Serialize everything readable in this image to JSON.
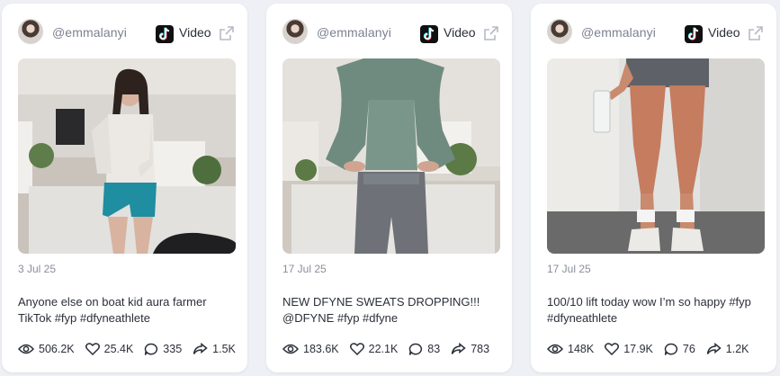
{
  "posts": [
    {
      "username": "@emmalanyi",
      "platform_label": "Video",
      "date": "3 Jul 25",
      "caption": "Anyone else on boat kid aura farmer TikTok #fyp #dfyneathlete",
      "stats": {
        "views": "506.2K",
        "likes": "25.4K",
        "comments": "335",
        "shares": "1.5K"
      }
    },
    {
      "username": "@emmalanyi",
      "platform_label": "Video",
      "date": "17 Jul 25",
      "caption": "NEW DFYNE SWEATS DROPPING!!! @DFYNE #fyp #dfyne",
      "stats": {
        "views": "183.6K",
        "likes": "22.1K",
        "comments": "83",
        "shares": "783"
      }
    },
    {
      "username": "@emmalanyi",
      "platform_label": "Video",
      "date": "17 Jul 25",
      "caption": "100/10 lift today wow I’m so happy #fyp #dfyneathlete",
      "stats": {
        "views": "148K",
        "likes": "17.9K",
        "comments": "76",
        "shares": "1.2K"
      }
    }
  ],
  "icons": {
    "platform": "tiktok-icon",
    "open": "external-link-icon",
    "views": "eye-icon",
    "likes": "heart-icon",
    "comments": "comment-icon",
    "shares": "share-icon"
  },
  "colors": {
    "page_background": "#eef0f5",
    "card_background": "#ffffff",
    "muted_text": "#7d8190",
    "body_text": "#2b2f3a"
  }
}
